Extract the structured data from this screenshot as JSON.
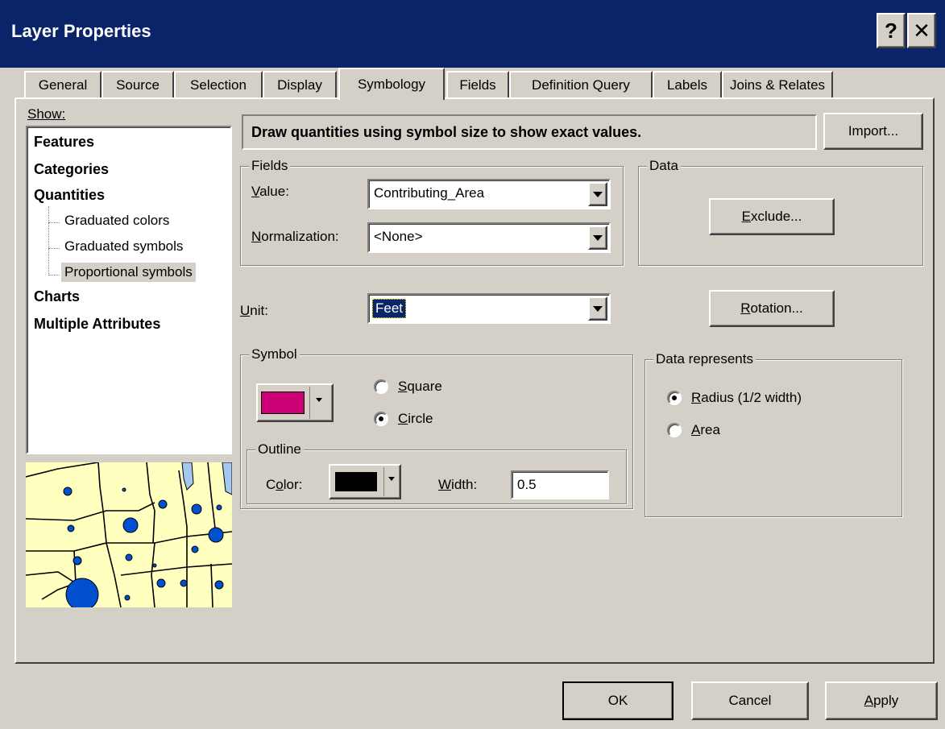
{
  "window": {
    "title": "Layer Properties",
    "help_glyph": "?",
    "close_glyph": "✕"
  },
  "tabs": [
    {
      "label": "General"
    },
    {
      "label": "Source"
    },
    {
      "label": "Selection"
    },
    {
      "label": "Display"
    },
    {
      "label": "Symbology",
      "active": true
    },
    {
      "label": "Fields"
    },
    {
      "label": "Definition Query"
    },
    {
      "label": "Labels"
    },
    {
      "label": "Joins & Relates"
    }
  ],
  "show": {
    "label": "Show:",
    "items": [
      {
        "label": "Features",
        "level": 0
      },
      {
        "label": "Categories",
        "level": 0
      },
      {
        "label": "Quantities",
        "level": 0
      },
      {
        "label": "Graduated colors",
        "level": 1
      },
      {
        "label": "Graduated symbols",
        "level": 1
      },
      {
        "label": "Proportional symbols",
        "level": 1,
        "selected": true
      },
      {
        "label": "Charts",
        "level": 0
      },
      {
        "label": "Multiple Attributes",
        "level": 0
      }
    ]
  },
  "description": "Draw quantities using symbol size to show exact values.",
  "import_button": "Import...",
  "fields": {
    "group_label": "Fields",
    "value_label": "Value:",
    "value": "Contributing_Area",
    "normalization_label": "Normalization:",
    "normalization": "<None>"
  },
  "data": {
    "group_label": "Data",
    "exclude_button": "Exclude..."
  },
  "unit": {
    "label": "Unit:",
    "value": "Feet"
  },
  "rotation_button": "Rotation...",
  "symbol": {
    "group_label": "Symbol",
    "fill_color": "#cc0077",
    "shape_options": [
      {
        "label": "Square",
        "selected": false
      },
      {
        "label": "Circle",
        "selected": true
      }
    ],
    "outline": {
      "group_label": "Outline",
      "color_label": "Color:",
      "color": "#000000",
      "width_label": "Width:",
      "width": "0.5"
    }
  },
  "data_represents": {
    "group_label": "Data represents",
    "options": [
      {
        "label": "Radius (1/2 width)",
        "selected": true
      },
      {
        "label": "Area",
        "selected": false
      }
    ]
  },
  "preview": {
    "land_color": "#ffffc0",
    "water_color": "#a6c8f0",
    "symbol_color": "#0050d0"
  },
  "footer": {
    "ok": "OK",
    "cancel": "Cancel",
    "apply": "Apply"
  }
}
